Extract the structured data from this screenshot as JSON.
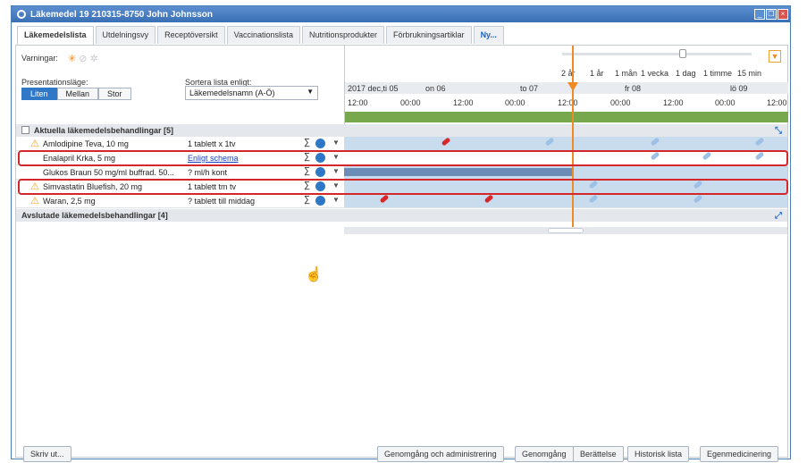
{
  "window": {
    "title": "Läkemedel 19 210315-8750 John Johnsson"
  },
  "tabs": [
    "Läkemedelslista",
    "Utdelningsvy",
    "Receptöversikt",
    "Vaccinationslista",
    "Nutritionsprodukter",
    "Förbrukningsartiklar",
    "Ny..."
  ],
  "controls": {
    "warnings_label": "Varningar:",
    "presentation_label": "Presentationsläge:",
    "presentation_options": [
      "Liten",
      "Mellan",
      "Stor"
    ],
    "sort_label": "Sortera lista enligt:",
    "sort_value": "Läkemedelsnamn (A-Ö)"
  },
  "timeline": {
    "zoom_levels": [
      "2 år",
      "1 år",
      "1 mån",
      "1 vecka",
      "1 dag",
      "1 timme",
      "15 min"
    ],
    "dates": [
      "2017 dec,ti 05",
      "on 06",
      "to 07",
      "fr 08",
      "lö 09"
    ],
    "times": [
      "12:00",
      "00:00",
      "12:00",
      "00:00",
      "12:00",
      "00:00",
      "12:00",
      "00:00",
      "12:00"
    ]
  },
  "current_section": {
    "title": "Aktuella läkemedelsbehandlingar [5]"
  },
  "rows": [
    {
      "name": "Amlodipine Teva, 10 mg",
      "dose": "1 tablett x 1tv",
      "sigma": "∑"
    },
    {
      "name": "Enalapril Krka, 5 mg",
      "dose": "Enligt schema",
      "sigma": "∑"
    },
    {
      "name": "Glukos Braun 50 mg/ml buffrad. 50...",
      "dose": "? ml/h kont",
      "sigma": "∑"
    },
    {
      "name": "Simvastatin Bluefish, 20 mg",
      "dose": "1 tablett tm tv",
      "sigma": "∑"
    },
    {
      "name": "Waran, 2,5 mg",
      "dose": "? tablett till middag",
      "sigma": "∑"
    }
  ],
  "ended_section": {
    "title": "Avslutade läkemedelsbehandlingar [4]"
  },
  "buttons": {
    "print": "Skriv ut...",
    "review_admin": "Genomgång och administrering",
    "review": "Genomgång",
    "story": "Berättelse",
    "history": "Historisk lista",
    "self_med": "Egenmedicinering"
  },
  "colors": {
    "accent": "#2f78c8",
    "warning": "#f0a030",
    "highlight": "#d4262b",
    "now_line": "#f08a24"
  }
}
